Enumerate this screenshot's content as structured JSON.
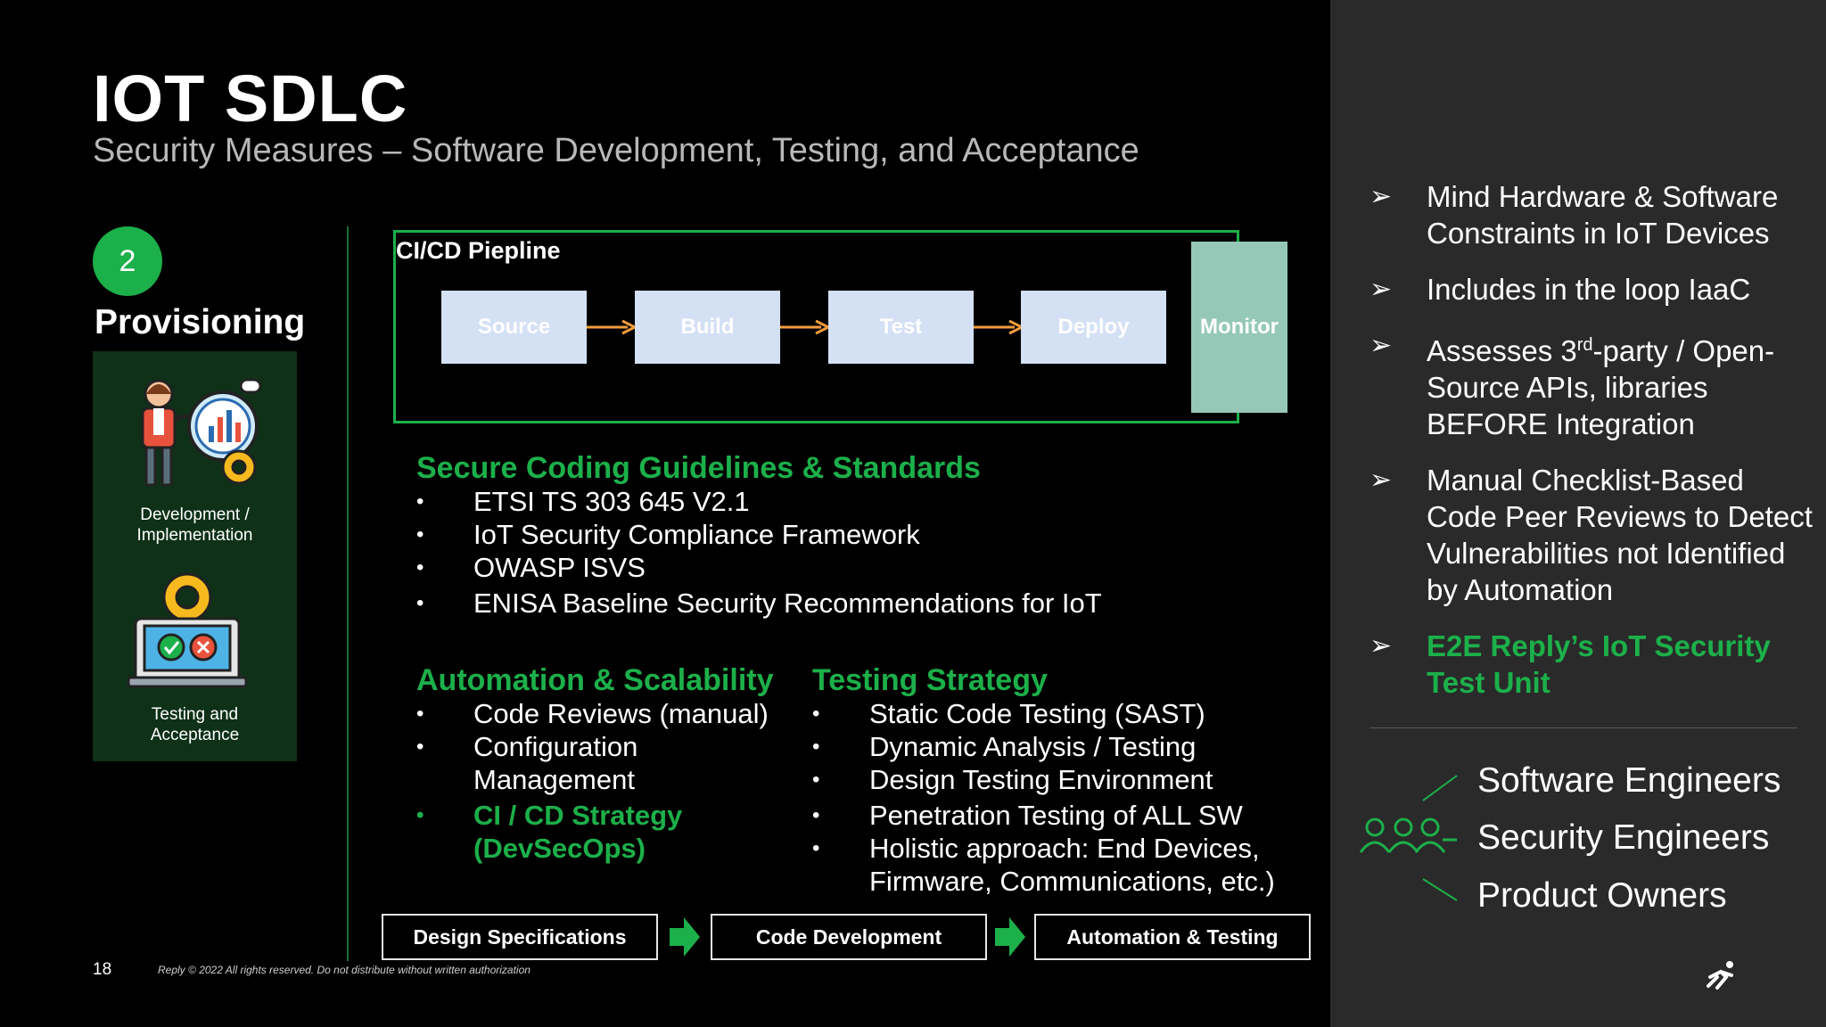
{
  "slide": {
    "title": "IOT SDLC",
    "subtitle": "Security Measures – Software Development, Testing, and Acceptance",
    "page_number": "18",
    "copyright": "Reply © 2022 All rights reserved. Do not distribute without written authorization"
  },
  "provisioning": {
    "step_number": "2",
    "label": "Provisioning",
    "items": [
      {
        "caption_line1": "Development /",
        "caption_line2": "Implementation",
        "icon": "presenter-analytics-icon"
      },
      {
        "caption_line1": "Testing and",
        "caption_line2": "Acceptance",
        "icon": "laptop-test-icon"
      }
    ]
  },
  "pipeline": {
    "title": "CI/CD Piepline",
    "stages": [
      "Source",
      "Build",
      "Test",
      "Deploy"
    ],
    "monitor": "Monitor"
  },
  "secure_coding": {
    "heading": "Secure Coding Guidelines & Standards",
    "items": [
      "ETSI TS 303 645 V2.1",
      "IoT Security Compliance Framework",
      "OWASP ISVS",
      "ENISA Baseline Security Recommendations for IoT"
    ]
  },
  "automation": {
    "heading": "Automation & Scalability",
    "items": [
      "Code Reviews (manual)",
      "Configuration Management"
    ],
    "highlight_item": "CI / CD Strategy (DevSecOps)"
  },
  "testing": {
    "heading": "Testing Strategy",
    "items": [
      "Static Code Testing (SAST)",
      "Dynamic Analysis / Testing",
      "Design Testing Environment",
      "Penetration Testing of ALL SW",
      "Holistic approach: End Devices, Firmware, Communications, etc.)"
    ]
  },
  "flow": [
    "Design Specifications",
    "Code Development",
    "Automation & Testing"
  ],
  "side": {
    "items": [
      "Mind Hardware & Software Constraints in IoT Devices",
      "Includes in the loop IaaC",
      "Manual Checklist-Based Code Peer Reviews to Detect Vulnerabilities not Identified by Automation"
    ],
    "assess_pre": "Assesses 3",
    "assess_sup": "rd",
    "assess_post": "-party / Open-Source APIs, libraries BEFORE Integration",
    "highlight": "E2E Reply’s IoT Security Test Unit",
    "roles": [
      "Software Engineers",
      "Security Engineers",
      "Product Owners"
    ]
  },
  "colors": {
    "accent_green": "#1cb04a",
    "panel_green": "#0e3118",
    "stage_fill": "#d4e0f4",
    "monitor_fill": "#96c8b8",
    "side_bg": "#2a2a2a",
    "arrow_orange": "#f39c3c"
  }
}
